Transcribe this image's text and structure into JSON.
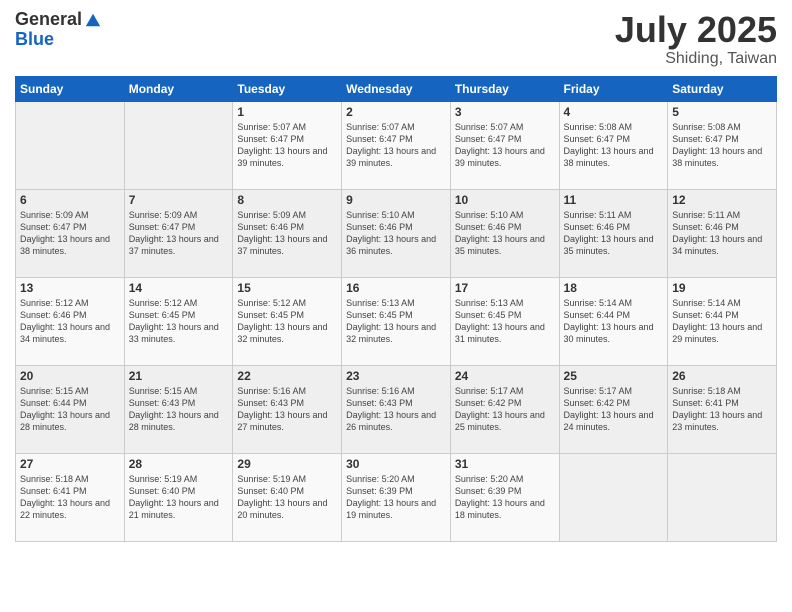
{
  "header": {
    "logo_general": "General",
    "logo_blue": "Blue",
    "month_year": "July 2025",
    "location": "Shiding, Taiwan"
  },
  "days_of_week": [
    "Sunday",
    "Monday",
    "Tuesday",
    "Wednesday",
    "Thursday",
    "Friday",
    "Saturday"
  ],
  "weeks": [
    [
      {
        "day": "",
        "info": ""
      },
      {
        "day": "",
        "info": ""
      },
      {
        "day": "1",
        "info": "Sunrise: 5:07 AM\nSunset: 6:47 PM\nDaylight: 13 hours and 39 minutes."
      },
      {
        "day": "2",
        "info": "Sunrise: 5:07 AM\nSunset: 6:47 PM\nDaylight: 13 hours and 39 minutes."
      },
      {
        "day": "3",
        "info": "Sunrise: 5:07 AM\nSunset: 6:47 PM\nDaylight: 13 hours and 39 minutes."
      },
      {
        "day": "4",
        "info": "Sunrise: 5:08 AM\nSunset: 6:47 PM\nDaylight: 13 hours and 38 minutes."
      },
      {
        "day": "5",
        "info": "Sunrise: 5:08 AM\nSunset: 6:47 PM\nDaylight: 13 hours and 38 minutes."
      }
    ],
    [
      {
        "day": "6",
        "info": "Sunrise: 5:09 AM\nSunset: 6:47 PM\nDaylight: 13 hours and 38 minutes."
      },
      {
        "day": "7",
        "info": "Sunrise: 5:09 AM\nSunset: 6:47 PM\nDaylight: 13 hours and 37 minutes."
      },
      {
        "day": "8",
        "info": "Sunrise: 5:09 AM\nSunset: 6:46 PM\nDaylight: 13 hours and 37 minutes."
      },
      {
        "day": "9",
        "info": "Sunrise: 5:10 AM\nSunset: 6:46 PM\nDaylight: 13 hours and 36 minutes."
      },
      {
        "day": "10",
        "info": "Sunrise: 5:10 AM\nSunset: 6:46 PM\nDaylight: 13 hours and 35 minutes."
      },
      {
        "day": "11",
        "info": "Sunrise: 5:11 AM\nSunset: 6:46 PM\nDaylight: 13 hours and 35 minutes."
      },
      {
        "day": "12",
        "info": "Sunrise: 5:11 AM\nSunset: 6:46 PM\nDaylight: 13 hours and 34 minutes."
      }
    ],
    [
      {
        "day": "13",
        "info": "Sunrise: 5:12 AM\nSunset: 6:46 PM\nDaylight: 13 hours and 34 minutes."
      },
      {
        "day": "14",
        "info": "Sunrise: 5:12 AM\nSunset: 6:45 PM\nDaylight: 13 hours and 33 minutes."
      },
      {
        "day": "15",
        "info": "Sunrise: 5:12 AM\nSunset: 6:45 PM\nDaylight: 13 hours and 32 minutes."
      },
      {
        "day": "16",
        "info": "Sunrise: 5:13 AM\nSunset: 6:45 PM\nDaylight: 13 hours and 32 minutes."
      },
      {
        "day": "17",
        "info": "Sunrise: 5:13 AM\nSunset: 6:45 PM\nDaylight: 13 hours and 31 minutes."
      },
      {
        "day": "18",
        "info": "Sunrise: 5:14 AM\nSunset: 6:44 PM\nDaylight: 13 hours and 30 minutes."
      },
      {
        "day": "19",
        "info": "Sunrise: 5:14 AM\nSunset: 6:44 PM\nDaylight: 13 hours and 29 minutes."
      }
    ],
    [
      {
        "day": "20",
        "info": "Sunrise: 5:15 AM\nSunset: 6:44 PM\nDaylight: 13 hours and 28 minutes."
      },
      {
        "day": "21",
        "info": "Sunrise: 5:15 AM\nSunset: 6:43 PM\nDaylight: 13 hours and 28 minutes."
      },
      {
        "day": "22",
        "info": "Sunrise: 5:16 AM\nSunset: 6:43 PM\nDaylight: 13 hours and 27 minutes."
      },
      {
        "day": "23",
        "info": "Sunrise: 5:16 AM\nSunset: 6:43 PM\nDaylight: 13 hours and 26 minutes."
      },
      {
        "day": "24",
        "info": "Sunrise: 5:17 AM\nSunset: 6:42 PM\nDaylight: 13 hours and 25 minutes."
      },
      {
        "day": "25",
        "info": "Sunrise: 5:17 AM\nSunset: 6:42 PM\nDaylight: 13 hours and 24 minutes."
      },
      {
        "day": "26",
        "info": "Sunrise: 5:18 AM\nSunset: 6:41 PM\nDaylight: 13 hours and 23 minutes."
      }
    ],
    [
      {
        "day": "27",
        "info": "Sunrise: 5:18 AM\nSunset: 6:41 PM\nDaylight: 13 hours and 22 minutes."
      },
      {
        "day": "28",
        "info": "Sunrise: 5:19 AM\nSunset: 6:40 PM\nDaylight: 13 hours and 21 minutes."
      },
      {
        "day": "29",
        "info": "Sunrise: 5:19 AM\nSunset: 6:40 PM\nDaylight: 13 hours and 20 minutes."
      },
      {
        "day": "30",
        "info": "Sunrise: 5:20 AM\nSunset: 6:39 PM\nDaylight: 13 hours and 19 minutes."
      },
      {
        "day": "31",
        "info": "Sunrise: 5:20 AM\nSunset: 6:39 PM\nDaylight: 13 hours and 18 minutes."
      },
      {
        "day": "",
        "info": ""
      },
      {
        "day": "",
        "info": ""
      }
    ]
  ]
}
